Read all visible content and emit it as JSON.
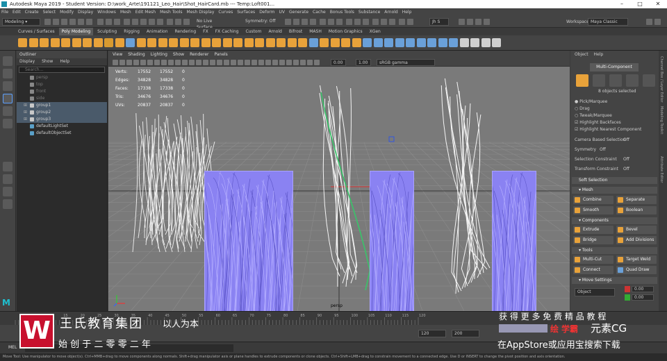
{
  "window": {
    "title": "Autodesk Maya 2019 - Student Version: D:\\work_Arte\\191121_Leo_Hair\\Shot_HairCard.mb  ---  Temp:Loft001..."
  },
  "menubar": [
    "File",
    "Edit",
    "Create",
    "Select",
    "Modify",
    "Display",
    "Windows",
    "Mesh",
    "Edit Mesh",
    "Mesh Tools",
    "Mesh Display",
    "Curves",
    "Surfaces",
    "Deform",
    "UV",
    "Generate",
    "Cache",
    "Bonus Tools",
    "Substance",
    "Arnold",
    "Help"
  ],
  "status": {
    "mode": "Modeling",
    "live_surface": "No Live Surface",
    "symmetry": "Symmetry: Off",
    "user": "Jh S",
    "workspace_label": "Workspace :",
    "workspace": "Maya Classic"
  },
  "shelf_tabs": [
    {
      "label": "Curves / Surfaces",
      "active": false
    },
    {
      "label": "Poly Modeling",
      "active": true
    },
    {
      "label": "Sculpting",
      "active": false
    },
    {
      "label": "Rigging",
      "active": false
    },
    {
      "label": "Animation",
      "active": false
    },
    {
      "label": "Rendering",
      "active": false
    },
    {
      "label": "FX",
      "active": false
    },
    {
      "label": "FX Caching",
      "active": false
    },
    {
      "label": "Custom",
      "active": false
    },
    {
      "label": "Arnold",
      "active": false
    },
    {
      "label": "Bifrost",
      "active": false
    },
    {
      "label": "MASH",
      "active": false
    },
    {
      "label": "Motion Graphics",
      "active": false
    },
    {
      "label": "XGen",
      "active": false
    }
  ],
  "outliner": {
    "title": "Outliner",
    "menu": [
      "Display",
      "Show",
      "Help"
    ],
    "search_placeholder": "Search...",
    "items": [
      {
        "label": "persp",
        "selected": false,
        "indent": 1
      },
      {
        "label": "top",
        "selected": false,
        "indent": 1
      },
      {
        "label": "front",
        "selected": false,
        "indent": 1
      },
      {
        "label": "side",
        "selected": false,
        "indent": 1
      },
      {
        "label": "group1",
        "selected": true,
        "indent": 0
      },
      {
        "label": "group2",
        "selected": true,
        "indent": 0
      },
      {
        "label": "group3",
        "selected": true,
        "indent": 0
      },
      {
        "label": "defaultLightSet",
        "selected": false,
        "indent": 1
      },
      {
        "label": "defaultObjectSet",
        "selected": false,
        "indent": 1
      }
    ]
  },
  "viewport": {
    "menu": [
      "View",
      "Shading",
      "Lighting",
      "Show",
      "Renderer",
      "Panels"
    ],
    "exposure": "0.00",
    "gamma": "1.00",
    "color_space": "sRGB gamma",
    "camera": "persp",
    "hud": [
      {
        "label": "Verts:",
        "a": "17552",
        "b": "17552",
        "c": "0"
      },
      {
        "label": "Edges:",
        "a": "34828",
        "b": "34828",
        "c": "0"
      },
      {
        "label": "Faces:",
        "a": "17338",
        "b": "17338",
        "c": "0"
      },
      {
        "label": "Tris:",
        "a": "34676",
        "b": "34676",
        "c": "0"
      },
      {
        "label": "UVs:",
        "a": "20837",
        "b": "20837",
        "c": "0"
      }
    ]
  },
  "right_panel": {
    "menu": [
      "Object",
      "Help"
    ],
    "mode": "Multi-Component",
    "selected": "8 objects selected",
    "options": [
      {
        "label": "Pick/Marquee",
        "type": "radio",
        "on": true
      },
      {
        "label": "Drag",
        "type": "radio",
        "on": false
      },
      {
        "label": "Tweak/Marquee",
        "type": "radio",
        "on": false
      },
      {
        "label": "Highlight Backfaces",
        "type": "check",
        "on": true
      },
      {
        "label": "Highlight Nearest Component",
        "type": "check",
        "on": true
      }
    ],
    "settings": [
      {
        "label": "Camera Based Selection",
        "value": "Off"
      },
      {
        "label": "Symmetry",
        "value": "Off"
      },
      {
        "label": "Selection Constraint",
        "value": "Off"
      },
      {
        "label": "Transform Constraint",
        "value": "Off"
      }
    ],
    "soft": "Soft Selection",
    "sections": {
      "mesh": "Mesh",
      "components": "Components",
      "tools": "Tools",
      "move": "Move Settings"
    },
    "mesh_buttons": [
      "Combine",
      "Separate",
      "Smooth",
      "Boolean"
    ],
    "comp_buttons": [
      "Extrude",
      "Bevel",
      "Bridge",
      "Add Divisions"
    ],
    "tool_buttons": [
      "Multi-Cut",
      "Target Weld",
      "Connect",
      "Quad Draw"
    ],
    "move": {
      "label": "Object",
      "x": "0.00",
      "y": "0.00"
    },
    "side_tabs": [
      "Channel Box / Layer Editor",
      "Modeling Toolkit",
      "Attribute Editor"
    ]
  },
  "timeline": {
    "ticks": [
      "5",
      "10",
      "15",
      "20",
      "25",
      "30",
      "35",
      "40",
      "45",
      "50",
      "55",
      "60",
      "65",
      "70",
      "75",
      "80",
      "85",
      "90",
      "95",
      "100",
      "105",
      "110",
      "115",
      "120"
    ]
  },
  "range": {
    "start": "120",
    "end": "200"
  },
  "mel": {
    "label": "MEL",
    "help": "Move Tool: Use manipulator to move object(s). Ctrl+MMB+drag to move components along normals. Shift+drag manipulator axis or plane handles to extrude components or clone objects. Ctrl+Shift+LMB+drag to constrain movement to a connected edge. Use D or INSERT to change the pivot position and axis orientation."
  },
  "watermark": {
    "brand": "王氏教育集团",
    "slogan": "以人为本",
    "founded": "始 创 于 二 零 零 二 年",
    "promo1": "获 得 更 多 免 费 精 品 教 程",
    "promo2": "在AppStore或应用宝搜索下载",
    "cg_logo_a": "绘",
    "cg_logo_b": "学霸",
    "cg_logo_c": "元素CG"
  },
  "colors": {
    "viewport_bg": "#7a7a7a",
    "card": "#8a82f2",
    "accent": "#3a7bd5",
    "selected": "#4a5a6a"
  }
}
